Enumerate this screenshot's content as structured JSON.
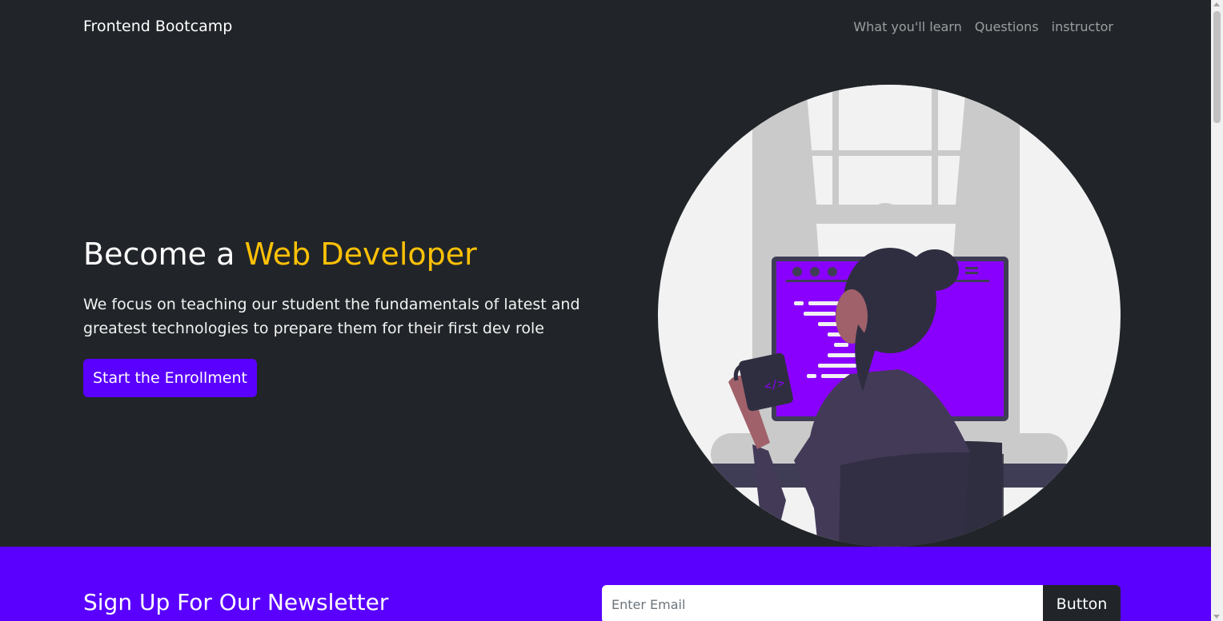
{
  "navbar": {
    "brand": "Frontend Bootcamp",
    "links": [
      {
        "label": "What you'll learn"
      },
      {
        "label": "Questions"
      },
      {
        "label": "instructor"
      }
    ]
  },
  "hero": {
    "title_prefix": "Become a ",
    "title_accent": "Web Developer",
    "lead": "We focus on teaching our student the fundamentals of latest and greatest technologies to prepare them for their first dev role",
    "cta_label": "Start the Enrollment"
  },
  "newsletter": {
    "title": "Sign Up For Our Newsletter",
    "email_placeholder": "Enter Email",
    "email_value": "",
    "button_label": "Button"
  },
  "colors": {
    "background": "#212529",
    "brand_purple": "#5a00ff",
    "accent_yellow": "#ffc107"
  },
  "icons": {
    "illustration": "developer-illustration",
    "mug_code": "code-icon"
  }
}
